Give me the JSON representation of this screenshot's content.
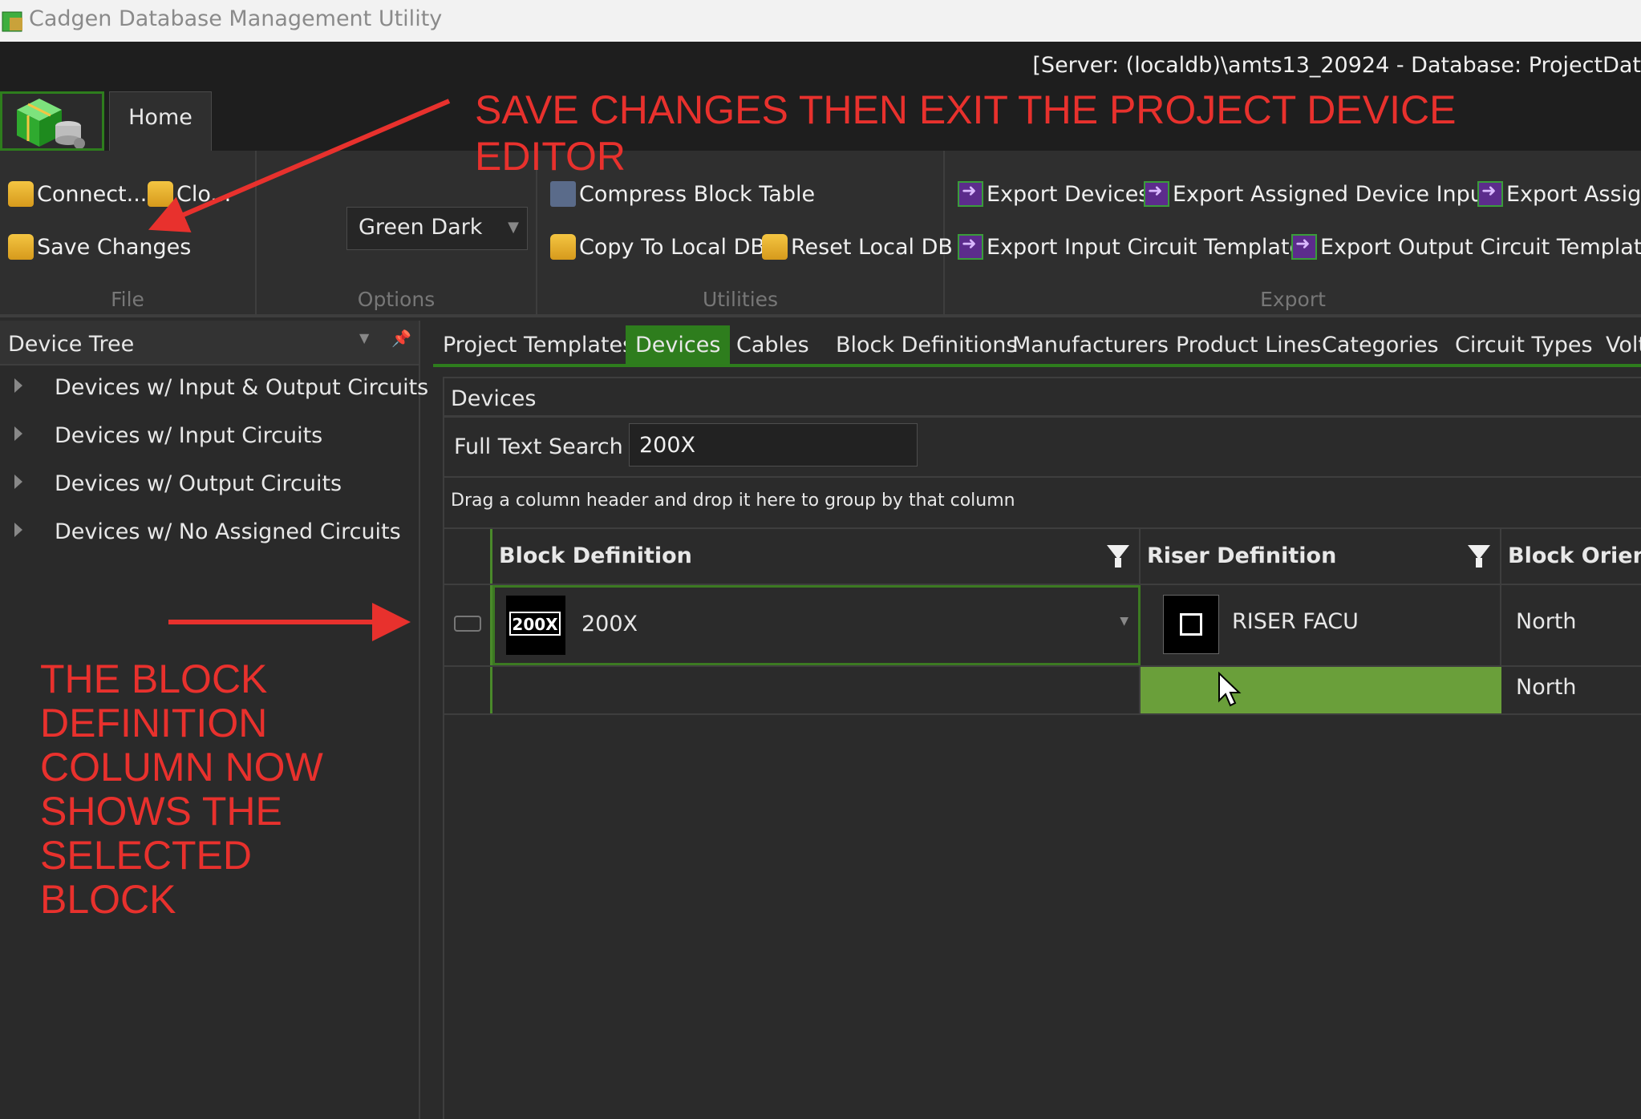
{
  "window": {
    "title": "Cadgen Database Management Utility"
  },
  "server_info": "[Server: (localdb)\\amts13_20924 - Database: ProjectDat",
  "ribbon": {
    "home_tab": "Home",
    "file": {
      "label": "File",
      "connect": "Connect...",
      "close": "Clo...",
      "save_changes": "Save Changes"
    },
    "options": {
      "label": "Options",
      "theme": "Green Dark"
    },
    "utilities": {
      "label": "Utilities",
      "compress": "Compress Block Table",
      "copy_local": "Copy To Local DB",
      "reset_local": "Reset Local DB"
    },
    "export": {
      "label": "Export",
      "export_devices": "Export Devices",
      "export_assigned_inputs": "Export Assigned Device Inputs",
      "export_assigned_cut": "Export Assigne",
      "export_input_templates": "Export Input Circuit Templates",
      "export_output_templates": "Export Output Circuit Templates"
    }
  },
  "device_tree": {
    "title": "Device Tree",
    "items": [
      {
        "label": "Devices w/ Input & Output Circuits"
      },
      {
        "label": "Devices w/ Input Circuits"
      },
      {
        "label": "Devices w/ Output Circuits"
      },
      {
        "label": "Devices w/ No Assigned Circuits"
      }
    ]
  },
  "main_tabs": [
    {
      "label": "Project Templates"
    },
    {
      "label": "Devices"
    },
    {
      "label": "Cables"
    },
    {
      "label": "Block Definitions"
    },
    {
      "label": "Manufacturers"
    },
    {
      "label": "Product Lines"
    },
    {
      "label": "Categories"
    },
    {
      "label": "Circuit Types"
    },
    {
      "label": "Volt"
    }
  ],
  "devices_panel": {
    "title": "Devices",
    "search_label": "Full Text Search",
    "search_value": "200X",
    "group_hint": "Drag a column header and drop it here to group by that column",
    "columns": [
      "Block Definition",
      "Riser Definition",
      "Block Orienta"
    ],
    "rows": [
      {
        "block_thumb_label": "200X",
        "block": "200X",
        "riser": "RISER FACU",
        "orientation": "North"
      },
      {
        "block": "",
        "riser": "",
        "orientation": "North"
      }
    ]
  },
  "annotations": {
    "top": "SAVE CHANGES THEN EXIT THE PROJECT DEVICE EDITOR",
    "left": "THE BLOCK DEFINITION COLUMN NOW SHOWS THE SELECTED BLOCK"
  },
  "colors": {
    "accent_green": "#2e7d1d",
    "annotation_red": "#e8312d",
    "selected_cell": "#6a9f3a"
  }
}
